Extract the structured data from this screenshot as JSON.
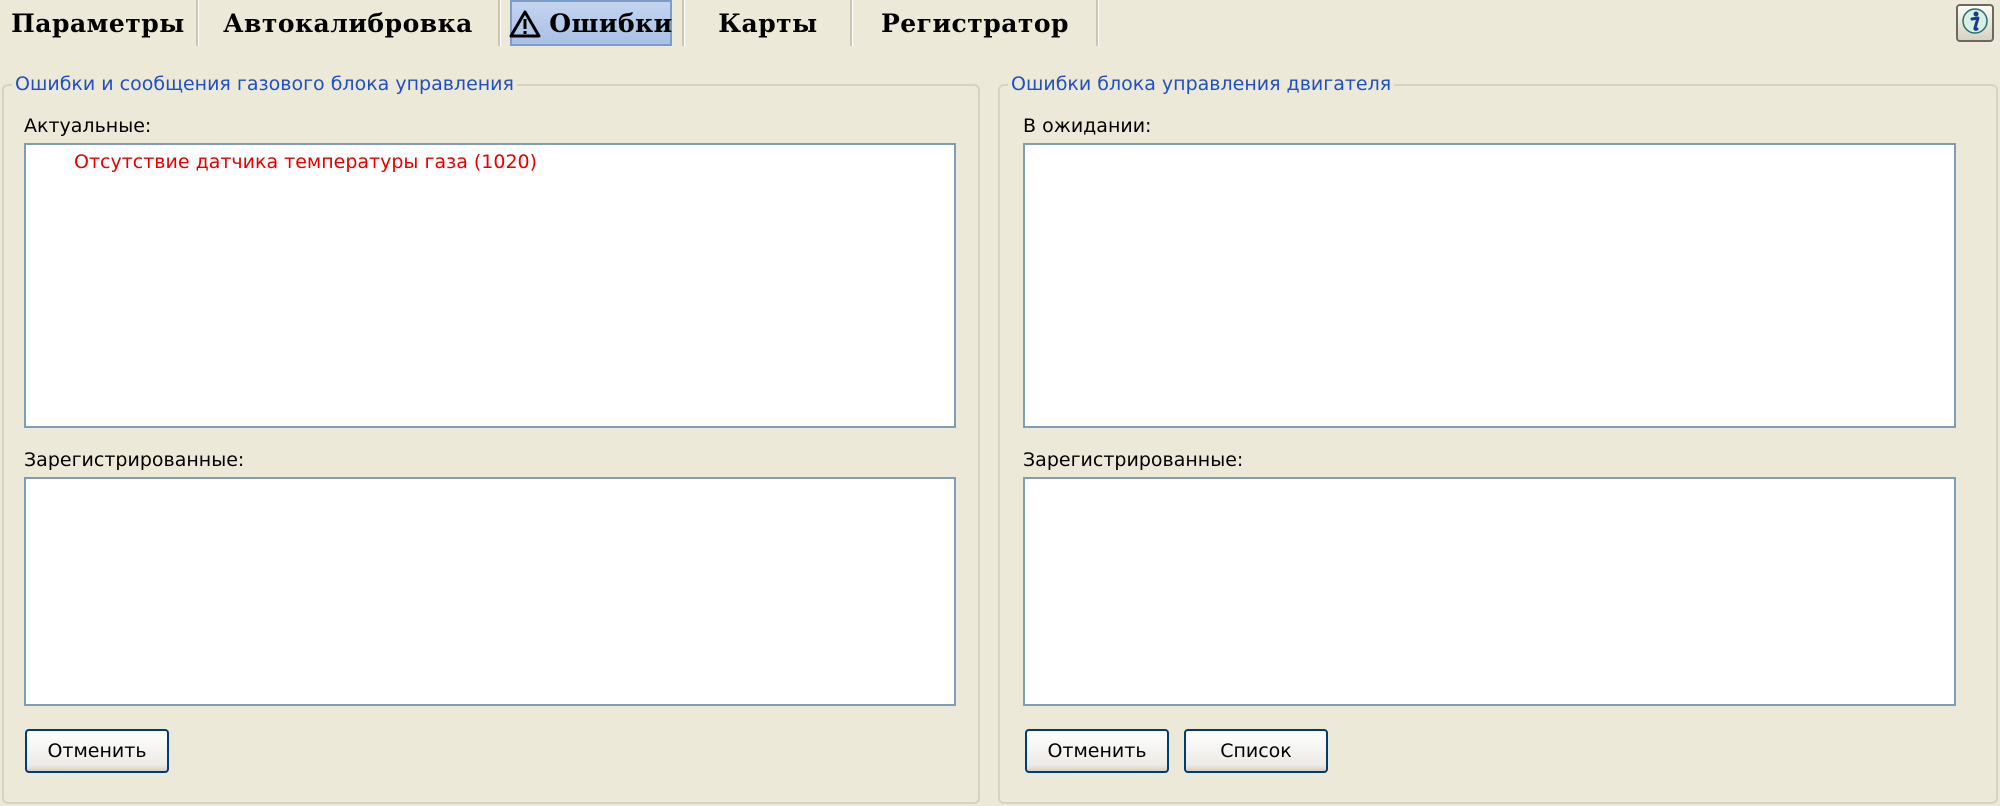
{
  "tabs": [
    {
      "label": "Параметры",
      "active": false
    },
    {
      "label": "Автокалибровка",
      "active": false
    },
    {
      "label": "Ошибки",
      "active": true,
      "icon": "warning-triangle-icon"
    },
    {
      "label": "Карты",
      "active": false
    },
    {
      "label": "Регистратор",
      "active": false
    }
  ],
  "help_button": {
    "icon": "info-icon"
  },
  "left_panel": {
    "title": "Ошибки и сообщения газового блока управления",
    "actual_label": "Актуальные:",
    "actual_items": [
      "Отсутствие датчика температуры газа (1020)"
    ],
    "registered_label": "Зарегистрированные:",
    "cancel_label": "Отменить"
  },
  "right_panel": {
    "title": "Ошибки блока управления двигателя",
    "pending_label": "В ожидании:",
    "registered_label": "Зарегистрированные:",
    "cancel_label": "Отменить",
    "list_label": "Список"
  },
  "colors": {
    "background": "#ece9d8",
    "group_title": "#1f4fc3",
    "error_text": "#e60000",
    "list_border": "#7f9db9"
  }
}
